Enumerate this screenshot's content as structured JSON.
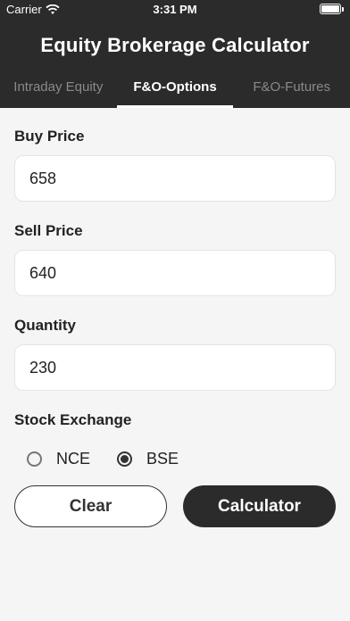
{
  "status": {
    "carrier": "Carrier",
    "time": "3:31 PM"
  },
  "header": {
    "title": "Equity Brokerage Calculator"
  },
  "tabs": [
    {
      "label": "Intraday Equity",
      "active": false
    },
    {
      "label": "F&O-Options",
      "active": true
    },
    {
      "label": "F&O-Futures",
      "active": false
    }
  ],
  "form": {
    "buy_price_label": "Buy Price",
    "buy_price_value": "658",
    "sell_price_label": "Sell Price",
    "sell_price_value": "640",
    "quantity_label": "Quantity",
    "quantity_value": "230",
    "exchange_label": "Stock Exchange",
    "exchanges": [
      {
        "label": "NCE",
        "selected": false
      },
      {
        "label": "BSE",
        "selected": true
      }
    ]
  },
  "actions": {
    "clear_label": "Clear",
    "calculate_label": "Calculator"
  }
}
